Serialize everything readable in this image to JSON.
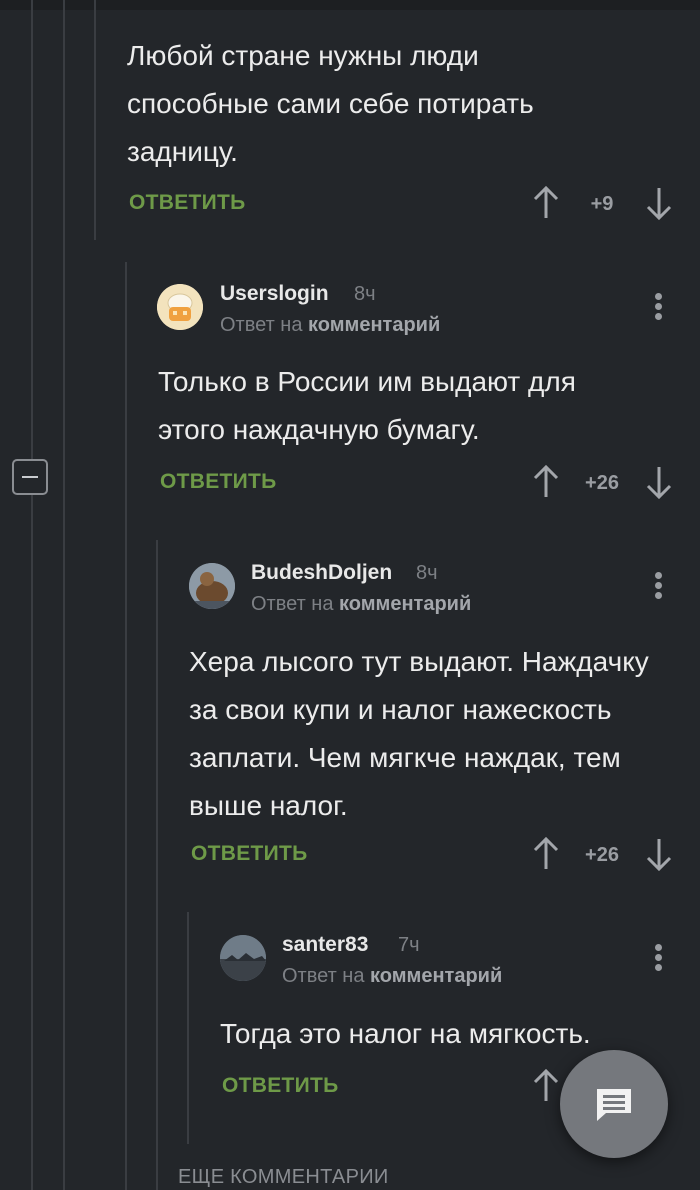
{
  "parent_comment": {
    "text": "Любой стране нужны люди способные сами себе потирать задницу.",
    "reply_label": "ОТВЕТИТЬ",
    "score": "+9"
  },
  "comments": [
    {
      "username": "Userslogin",
      "time": "8ч",
      "reply_prefix": "Ответ на",
      "reply_link": "комментарий",
      "text": "Только в России им выдают для этого наждачную бумагу.",
      "reply_label": "ОТВЕТИТЬ",
      "score": "+26"
    },
    {
      "username": "BudeshDoljen",
      "time": "8ч",
      "reply_prefix": "Ответ на",
      "reply_link": "комментарий",
      "text": "Хера лысого тут выдают. Наждачку за свои купи и налог нажескость заплати. Чем мягкче наждак, тем выше налог.",
      "reply_label": "ОТВЕТИТЬ",
      "score": "+26"
    },
    {
      "username": "santer83",
      "time": "7ч",
      "reply_prefix": "Ответ на",
      "reply_link": "комментарий",
      "text": "Тогда это налог на мягкость.",
      "reply_label": "ОТВЕТИТЬ",
      "score": ""
    }
  ],
  "more_comments_label": "ЕЩЕ КОММЕНТАРИИ",
  "icons": {
    "upvote": "arrow-up-icon",
    "downvote": "arrow-down-icon",
    "more": "vertical-dots-icon",
    "collapse": "minus-icon",
    "fab": "message-icon"
  },
  "colors": {
    "background": "#23262a",
    "reply_accent": "#6e9a48",
    "text": "#ececec",
    "muted": "#7d8085"
  }
}
